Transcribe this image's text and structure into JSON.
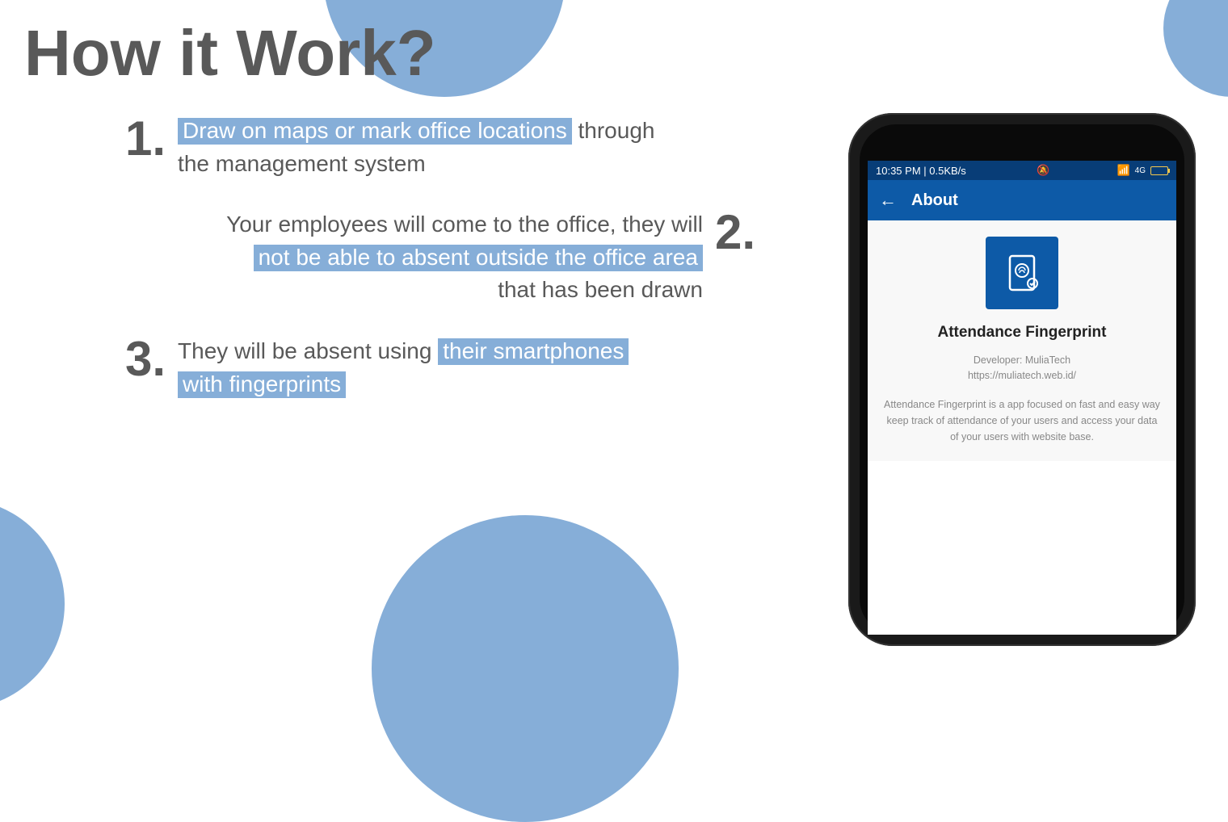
{
  "title": "How it Work?",
  "steps": {
    "one": {
      "num": "1.",
      "hl": "Draw on maps or mark office locations",
      "rest1": " through",
      "rest2": "the management system"
    },
    "two": {
      "num": "2.",
      "line1": "Your employees will come to the office, they will",
      "hl": "not be able to absent outside the office area",
      "line3": "that has been drawn"
    },
    "three": {
      "num": "3.",
      "pre": "They will be absent using ",
      "hl1": "their smartphones",
      "hl2": "with fingerprints"
    }
  },
  "phone": {
    "status_left": "10:35 PM | 0.5KB/s",
    "appbar_title": "About",
    "app_name": "Attendance Fingerprint",
    "developer": "Developer: MuliaTech",
    "url": "https://muliatech.web.id/",
    "description": "Attendance Fingerprint is a app focused on fast and easy way keep track of attendance of your users and access your data of your users with website base."
  }
}
